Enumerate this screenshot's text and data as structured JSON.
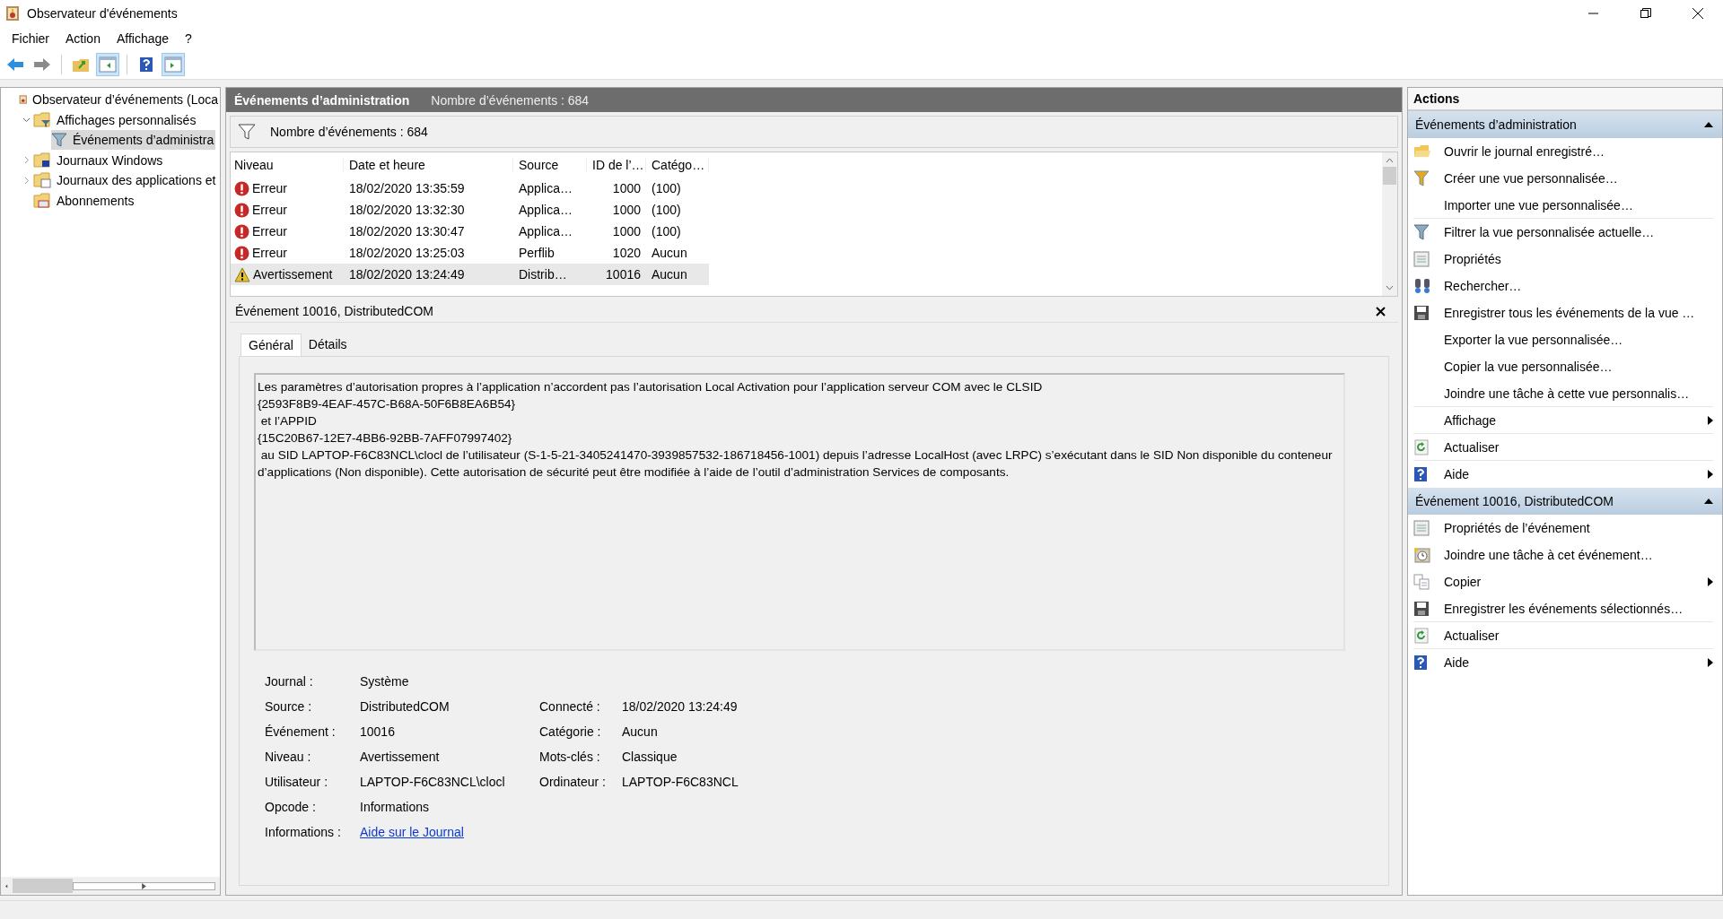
{
  "window": {
    "title": "Observateur d'événements"
  },
  "menu": [
    "Fichier",
    "Action",
    "Affichage",
    "?"
  ],
  "toolbar": [
    {
      "kind": "back",
      "pressed": false
    },
    {
      "kind": "forward",
      "pressed": false
    },
    {
      "kind": "up",
      "pressed": false
    },
    {
      "kind": "tree",
      "pressed": true
    },
    {
      "kind": "help",
      "pressed": false
    },
    {
      "kind": "actions",
      "pressed": true
    }
  ],
  "tree": [
    {
      "label": "Observateur d’événements (Loca",
      "kind": "root",
      "selected": false,
      "children": [
        {
          "label": "Affichages personnalisés",
          "kind": "views",
          "expanded": true,
          "selected": false,
          "children": [
            {
              "label": "Événements d’administra",
              "kind": "filter",
              "selected": true
            }
          ]
        },
        {
          "label": "Journaux Windows",
          "kind": "windows",
          "expanded": false,
          "selected": false
        },
        {
          "label": "Journaux des applications et",
          "kind": "apps",
          "expanded": false,
          "selected": false
        },
        {
          "label": "Abonnements",
          "kind": "subscriptions",
          "selected": false
        }
      ]
    }
  ],
  "view": {
    "title": "Événements d’administration",
    "count": "Nombre d’événements : 684",
    "filter_text": "Nombre d’événements : 684"
  },
  "table": {
    "columns": [
      "Niveau",
      "Date et heure",
      "Source",
      "ID de l’…",
      "Catégo…"
    ],
    "rows": [
      {
        "kind": "error",
        "level": "Erreur",
        "date": "18/02/2020 13:35:59",
        "source": "Applica…",
        "id": "1000",
        "category": "(100)",
        "selected": false
      },
      {
        "kind": "error",
        "level": "Erreur",
        "date": "18/02/2020 13:32:30",
        "source": "Applica…",
        "id": "1000",
        "category": "(100)",
        "selected": false
      },
      {
        "kind": "error",
        "level": "Erreur",
        "date": "18/02/2020 13:30:47",
        "source": "Applica…",
        "id": "1000",
        "category": "(100)",
        "selected": false
      },
      {
        "kind": "error",
        "level": "Erreur",
        "date": "18/02/2020 13:25:03",
        "source": "Perflib",
        "id": "1020",
        "category": "Aucun",
        "selected": false
      },
      {
        "kind": "warning",
        "level": "Avertissement",
        "date": "18/02/2020 13:24:49",
        "source": "Distrib…",
        "id": "10016",
        "category": "Aucun",
        "selected": true
      }
    ]
  },
  "details": {
    "title": "Événement 10016, DistributedCOM",
    "tabs": [
      {
        "label": "Général",
        "selected": true
      },
      {
        "label": "Détails",
        "selected": false
      }
    ],
    "description": "Les paramètres d’autorisation propres à l’application n’accordent pas l’autorisation Local Activation pour l’application serveur COM avec le CLSID\n{2593F8B9-4EAF-457C-B68A-50F6B8EA6B54}\n et l’APPID\n{15C20B67-12E7-4BB6-92BB-7AFF07997402}\n au SID LAPTOP-F6C83NCL\\clocl de l’utilisateur (S-1-5-21-3405241470-3939857532-186718456-1001) depuis l’adresse LocalHost (avec LRPC) s’exécutant dans le SID Non disponible du conteneur d’applications (Non disponible). Cette autorisation de sécurité peut être modifiée à l’aide de l’outil d’administration Services de composants.",
    "field_rows": [
      [
        {
          "label": "Journal :",
          "value": "Système",
          "kind": "text"
        }
      ],
      [
        {
          "label": "Source :",
          "value": "DistributedCOM",
          "kind": "text"
        },
        {
          "label": "Connecté :",
          "value": "18/02/2020 13:24:49",
          "kind": "text"
        }
      ],
      [
        {
          "label": "Événement :",
          "value": "10016",
          "kind": "text"
        },
        {
          "label": "Catégorie :",
          "value": "Aucun",
          "kind": "text"
        }
      ],
      [
        {
          "label": "Niveau :",
          "value": "Avertissement",
          "kind": "text"
        },
        {
          "label": "Mots-clés :",
          "value": "Classique",
          "kind": "text"
        }
      ],
      [
        {
          "label": "Utilisateur :",
          "value": "LAPTOP-F6C83NCL\\clocl",
          "kind": "text"
        },
        {
          "label": "Ordinateur :",
          "value": "LAPTOP-F6C83NCL",
          "kind": "text"
        }
      ],
      [
        {
          "label": "Opcode :",
          "value": "Informations",
          "kind": "text"
        }
      ],
      [
        {
          "label": "Informations :",
          "value": "Aide sur le Journal",
          "kind": "link"
        }
      ]
    ]
  },
  "actions": {
    "title": "Actions",
    "sections": [
      {
        "title": "Événements d’administration",
        "expanded": true,
        "items": [
          {
            "label": "Ouvrir le journal enregistré…",
            "kind": "open",
            "submenu": false,
            "divider": false
          },
          {
            "label": "Créer une vue personnalisée…",
            "kind": "create-filter",
            "submenu": false,
            "divider": false
          },
          {
            "label": "Importer une vue personnalisée…",
            "kind": "none",
            "submenu": false,
            "divider": true
          },
          {
            "label": "Filtrer la vue personnalisée actuelle…",
            "kind": "filter",
            "submenu": false,
            "divider": false
          },
          {
            "label": "Propriétés",
            "kind": "properties",
            "submenu": false,
            "divider": false
          },
          {
            "label": "Rechercher…",
            "kind": "find",
            "submenu": false,
            "divider": false
          },
          {
            "label": "Enregistrer tous les événements de la vue …",
            "kind": "save",
            "submenu": false,
            "divider": false
          },
          {
            "label": "Exporter la vue personnalisée…",
            "kind": "none",
            "submenu": false,
            "divider": false
          },
          {
            "label": "Copier la vue personnalisée…",
            "kind": "none",
            "submenu": false,
            "divider": false
          },
          {
            "label": "Joindre une tâche à cette vue personnalis…",
            "kind": "none",
            "submenu": false,
            "divider": true
          },
          {
            "label": "Affichage",
            "kind": "none",
            "submenu": true,
            "divider": true
          },
          {
            "label": "Actualiser",
            "kind": "refresh",
            "submenu": false,
            "divider": true
          },
          {
            "label": "Aide",
            "kind": "help",
            "submenu": true,
            "divider": false
          }
        ]
      },
      {
        "title": "Événement 10016, DistributedCOM",
        "expanded": true,
        "items": [
          {
            "label": "Propriétés de l’événement",
            "kind": "properties",
            "submenu": false,
            "divider": false
          },
          {
            "label": "Joindre une tâche à cet événement…",
            "kind": "task",
            "submenu": false,
            "divider": false
          },
          {
            "label": "Copier",
            "kind": "copy",
            "submenu": true,
            "divider": false
          },
          {
            "label": "Enregistrer les événements sélectionnés…",
            "kind": "save",
            "submenu": false,
            "divider": true
          },
          {
            "label": "Actualiser",
            "kind": "refresh",
            "submenu": false,
            "divider": true
          },
          {
            "label": "Aide",
            "kind": "help",
            "submenu": true,
            "divider": false
          }
        ]
      }
    ]
  }
}
